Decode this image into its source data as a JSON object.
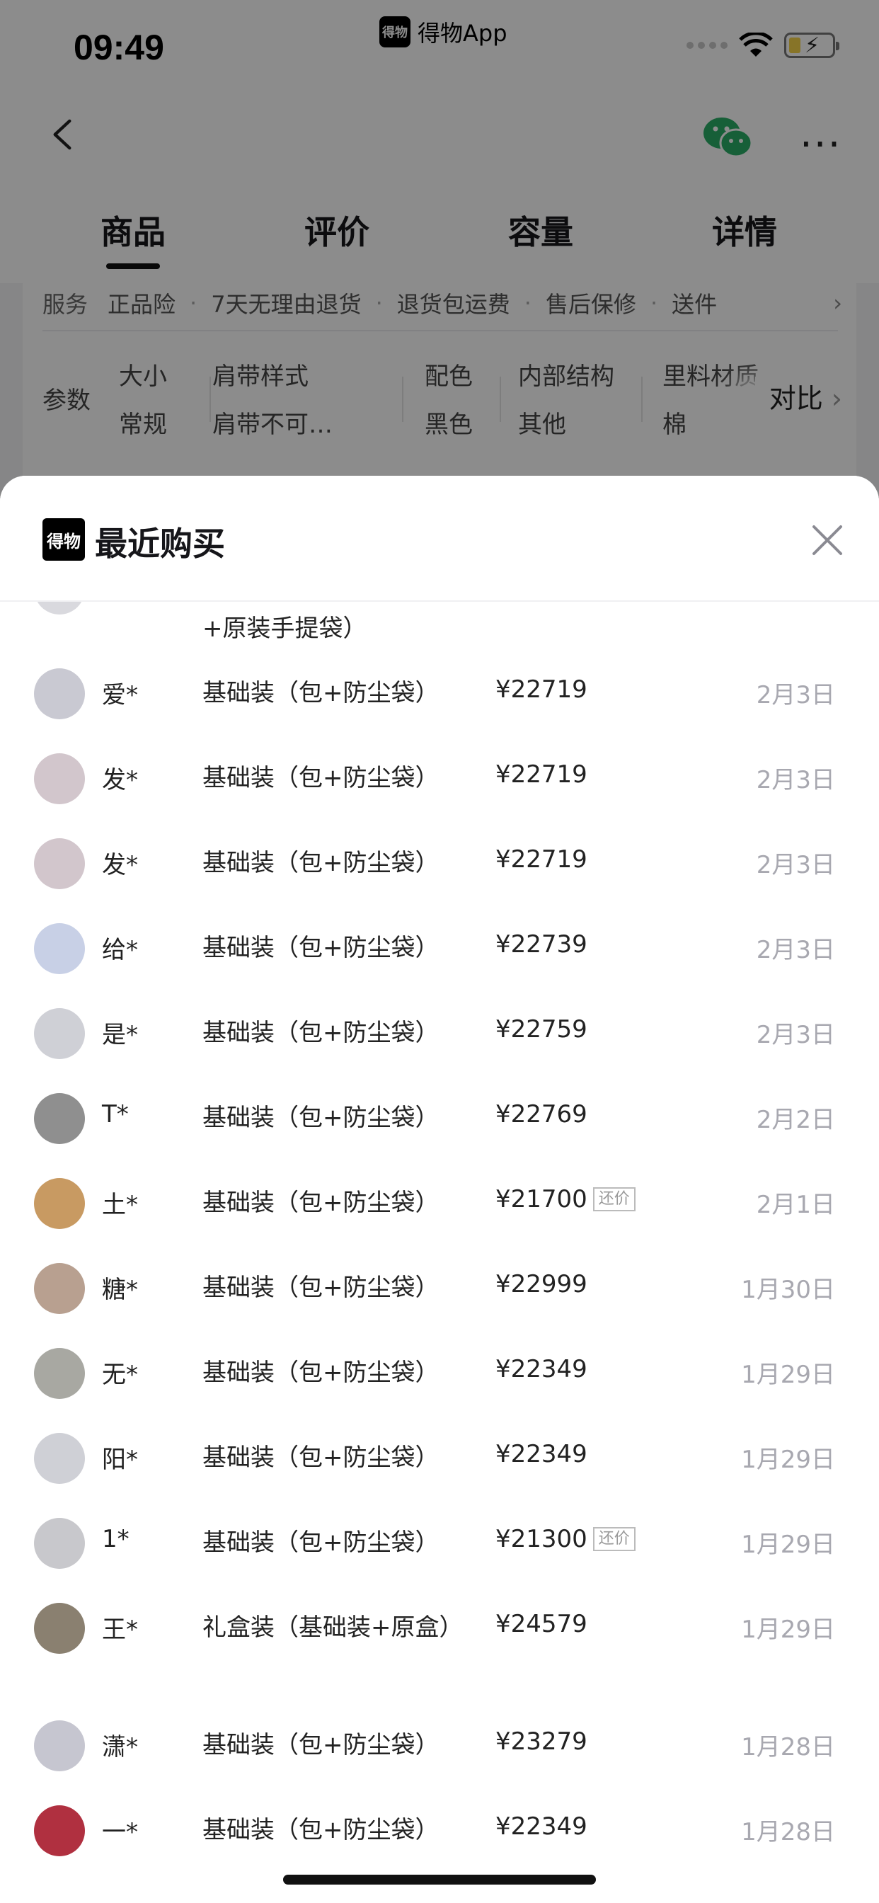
{
  "status_bar": {
    "time": "09:49",
    "app_name": "得物App",
    "app_logo_text": "得物"
  },
  "nav": {
    "back_icon": "chevron-left-icon",
    "share_icon": "wechat-icon",
    "more_icon": "more-horizontal-icon",
    "tabs": [
      {
        "label": "商品",
        "active": true
      },
      {
        "label": "评价",
        "active": false
      },
      {
        "label": "容量",
        "active": false
      },
      {
        "label": "详情",
        "active": false
      }
    ]
  },
  "service": {
    "label": "服务",
    "items": [
      "正品险",
      "7天无理由退货",
      "退货包运费",
      "售后保修",
      "送件"
    ]
  },
  "params": {
    "label": "参数",
    "items": [
      {
        "name": "大小",
        "value": "常规"
      },
      {
        "name": "肩带样式",
        "value": "肩带不可…"
      },
      {
        "name": "配色",
        "value": "黑色"
      },
      {
        "name": "内部结构",
        "value": "其他"
      },
      {
        "name": "里料材质",
        "value": "棉"
      }
    ],
    "compare_label": "对比"
  },
  "sheet": {
    "logo_text": "得物",
    "title": "最近购买",
    "close_icon": "close-icon",
    "partial_row_text": "+原装手提袋）",
    "rows": [
      {
        "user": "爱*",
        "spec": "基础装（包+防尘袋）",
        "price": "¥22719",
        "badge": "",
        "date": "2月3日",
        "avatar_color": "#c9c9d2"
      },
      {
        "user": "发*",
        "spec": "基础装（包+防尘袋）",
        "price": "¥22719",
        "badge": "",
        "date": "2月3日",
        "avatar_color": "#d2c6cc"
      },
      {
        "user": "发*",
        "spec": "基础装（包+防尘袋）",
        "price": "¥22719",
        "badge": "",
        "date": "2月3日",
        "avatar_color": "#d2c6cc"
      },
      {
        "user": "给*",
        "spec": "基础装（包+防尘袋）",
        "price": "¥22739",
        "badge": "",
        "date": "2月3日",
        "avatar_color": "#c8d0e6"
      },
      {
        "user": "是*",
        "spec": "基础装（包+防尘袋）",
        "price": "¥22759",
        "badge": "",
        "date": "2月3日",
        "avatar_color": "#cfd0d6"
      },
      {
        "user": "T*",
        "spec": "基础装（包+防尘袋）",
        "price": "¥22769",
        "badge": "",
        "date": "2月2日",
        "avatar_color": "#8f8f8f"
      },
      {
        "user": "土*",
        "spec": "基础装（包+防尘袋）",
        "price": "¥21700",
        "badge": "还价",
        "date": "2月1日",
        "avatar_color": "#c89a62"
      },
      {
        "user": "糖*",
        "spec": "基础装（包+防尘袋）",
        "price": "¥22999",
        "badge": "",
        "date": "1月30日",
        "avatar_color": "#b8a090"
      },
      {
        "user": "无*",
        "spec": "基础装（包+防尘袋）",
        "price": "¥22349",
        "badge": "",
        "date": "1月29日",
        "avatar_color": "#a8a8a2"
      },
      {
        "user": "阳*",
        "spec": "基础装（包+防尘袋）",
        "price": "¥22349",
        "badge": "",
        "date": "1月29日",
        "avatar_color": "#cfd0d6"
      },
      {
        "user": "1*",
        "spec": "基础装（包+防尘袋）",
        "price": "¥21300",
        "badge": "还价",
        "date": "1月29日",
        "avatar_color": "#c8c8cc"
      },
      {
        "user": "王*",
        "spec": "礼盒装（基础装+原盒）",
        "price": "¥24579",
        "badge": "",
        "date": "1月29日",
        "avatar_color": "#8a8070"
      },
      {
        "user": "潇*",
        "spec": "基础装（包+防尘袋）",
        "price": "¥23279",
        "badge": "",
        "date": "1月28日",
        "avatar_color": "#c6c6d0"
      },
      {
        "user": "一*",
        "spec": "基础装（包+防尘袋）",
        "price": "¥22349",
        "badge": "",
        "date": "1月28日",
        "avatar_color": "#b03040"
      }
    ]
  }
}
